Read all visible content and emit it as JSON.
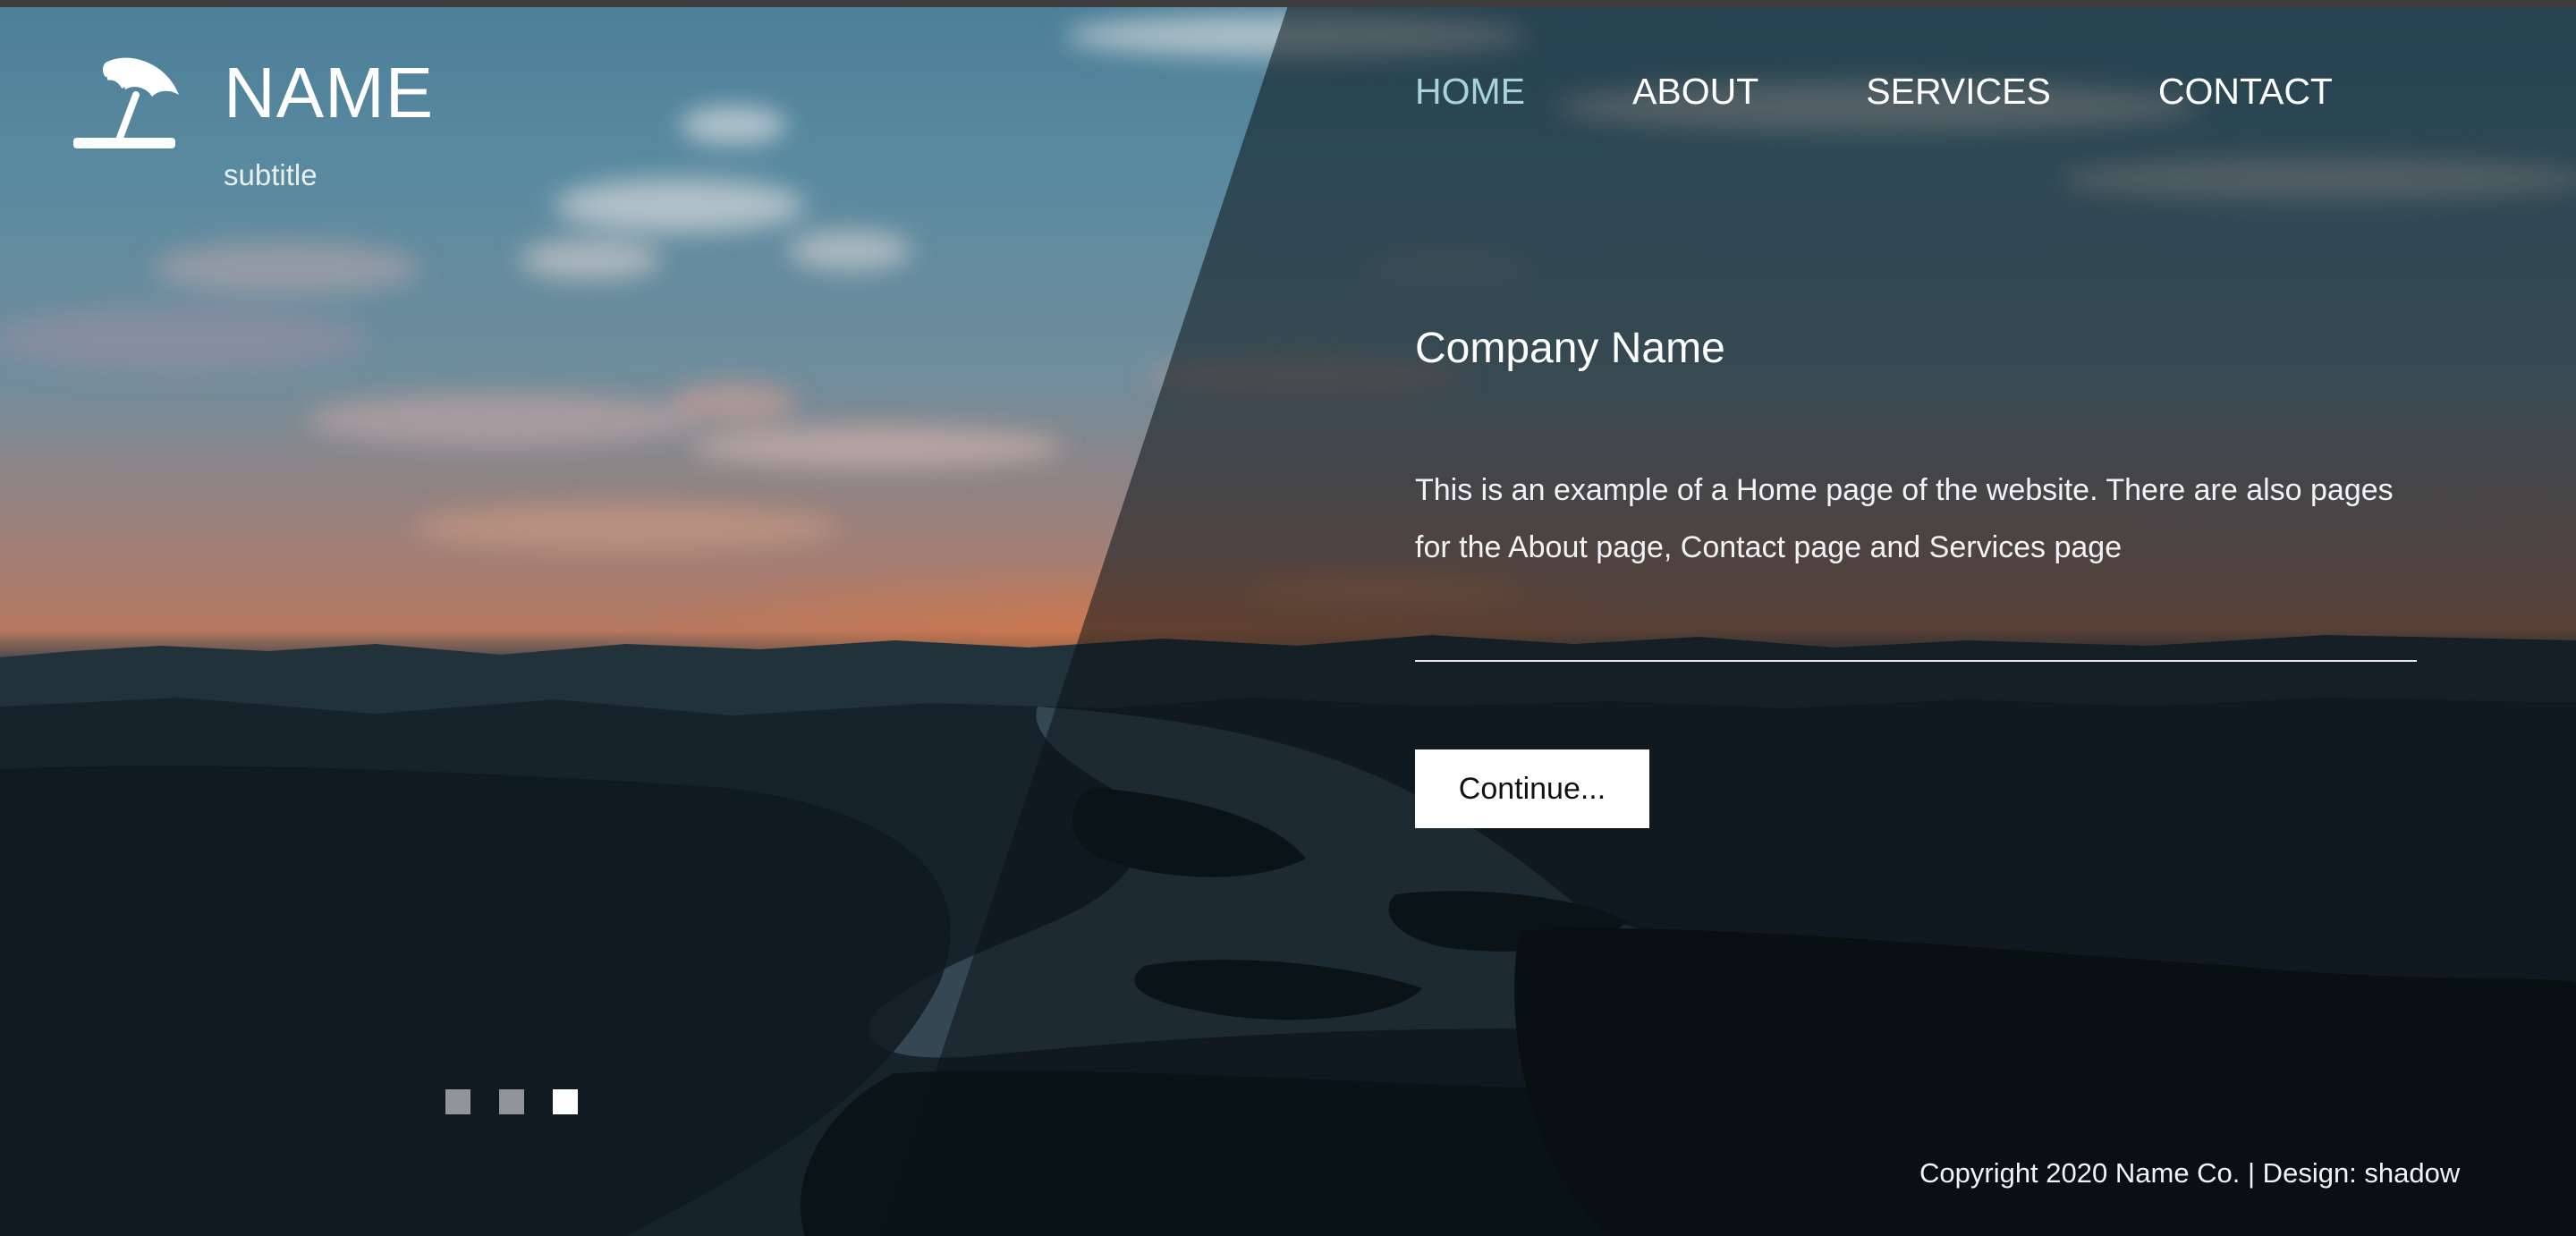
{
  "brand": {
    "name": "NAME",
    "subtitle": "subtitle",
    "logo_icon": "beach-umbrella-icon"
  },
  "nav": {
    "items": [
      {
        "label": "HOME",
        "active": true
      },
      {
        "label": "ABOUT",
        "active": false
      },
      {
        "label": "SERVICES",
        "active": false
      },
      {
        "label": "CONTACT",
        "active": false
      }
    ],
    "active_color": "#a9d4d6"
  },
  "hero": {
    "title": "Company Name",
    "text": "This is an example of a Home page of the website. There are also pages for the About page, Contact page and Services page",
    "button_label": "Continue..."
  },
  "slider": {
    "count": 3,
    "active_index": 2
  },
  "footer": {
    "copyright": "Copyright 2020 Name Co. | Design: shadow"
  }
}
